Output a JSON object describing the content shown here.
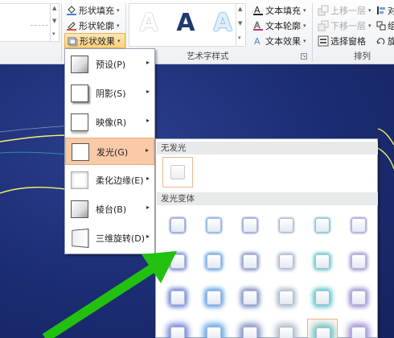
{
  "ribbon": {
    "shape_cmds": [
      {
        "label": "形状填充",
        "icon": "paint-bucket-icon"
      },
      {
        "label": "形状轮廓",
        "icon": "pen-outline-icon"
      },
      {
        "label": "形状效果",
        "icon": "shape-effects-icon"
      }
    ],
    "wordart_styles": [
      "A",
      "A",
      "A"
    ],
    "text_cmds": [
      {
        "label": "文本填充",
        "icon": "text-fill-icon"
      },
      {
        "label": "文本轮廓",
        "icon": "text-outline-icon"
      },
      {
        "label": "文本效果",
        "icon": "text-effects-icon"
      }
    ],
    "wordart_group_label": "艺术字样式",
    "arrange_cmds": [
      {
        "label": "上移一层",
        "icon": "bring-forward-icon",
        "disabled": true
      },
      {
        "label": "下移一层",
        "icon": "send-backward-icon",
        "disabled": true
      },
      {
        "label": "选择窗格",
        "icon": "selection-pane-icon",
        "disabled": false
      }
    ],
    "arrange_side": [
      "对",
      "组",
      "旋"
    ],
    "arrange_group_label": "排列"
  },
  "effects_menu": {
    "items": [
      {
        "label": "预设(P)",
        "hotkey": "P"
      },
      {
        "label": "阴影(S)",
        "hotkey": "S"
      },
      {
        "label": "映像(R)",
        "hotkey": "R"
      },
      {
        "label": "发光(G)",
        "hotkey": "G"
      },
      {
        "label": "柔化边缘(E)",
        "hotkey": "E"
      },
      {
        "label": "棱台(B)",
        "hotkey": "B"
      },
      {
        "label": "三维旋转(D)",
        "hotkey": "D"
      }
    ],
    "active_index": 3
  },
  "glow_menu": {
    "no_glow_header": "无发光",
    "variants_header": "发光变体",
    "glow_colors": [
      "#6b7fd7",
      "#5aa0e6",
      "#7b8bc4",
      "#b0bcc9",
      "#5dc6c6",
      "#9a8fd0"
    ],
    "rows": 4,
    "hover_row": 3,
    "hover_col": 4
  },
  "colors": {
    "slide_bg": "#1b2c72",
    "menu_highlight": "#f9c9a8",
    "arrow_green": "#22c10f",
    "curve_yellow": "#f2f26a"
  }
}
